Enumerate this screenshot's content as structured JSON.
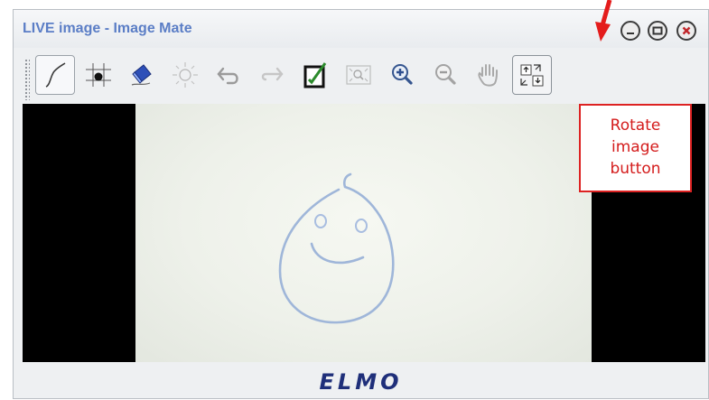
{
  "window": {
    "title": "LIVE image - Image Mate",
    "buttons": [
      {
        "name": "minimize",
        "icon": "minimize-icon"
      },
      {
        "name": "maximize",
        "icon": "maximize-icon"
      },
      {
        "name": "close",
        "icon": "close-icon"
      }
    ]
  },
  "toolbar": {
    "tools": [
      {
        "name": "pen",
        "icon": "pen-curve-icon",
        "selected": true
      },
      {
        "name": "pointer",
        "icon": "crosshair-dot-icon"
      },
      {
        "name": "eraser",
        "icon": "eraser-icon"
      },
      {
        "name": "highlight",
        "icon": "sun-icon"
      },
      {
        "name": "undo",
        "icon": "undo-arrow-icon"
      },
      {
        "name": "redo",
        "icon": "redo-arrow-icon"
      },
      {
        "name": "save",
        "icon": "edit-save-icon"
      },
      {
        "name": "fit",
        "icon": "zoom-fit-icon"
      },
      {
        "name": "zoom-in",
        "icon": "zoom-in-icon"
      },
      {
        "name": "zoom-out",
        "icon": "zoom-out-icon"
      },
      {
        "name": "pan",
        "icon": "hand-icon"
      },
      {
        "name": "rotate",
        "icon": "rotate-image-icon",
        "highlighted": true
      }
    ]
  },
  "footer": {
    "logo": "ELMO"
  },
  "callout": {
    "lines": [
      "Rotate",
      "image",
      "button"
    ]
  },
  "colors": {
    "title": "#5b7ec6",
    "callout": "#d41c1c",
    "logo": "#1f2f7a"
  }
}
